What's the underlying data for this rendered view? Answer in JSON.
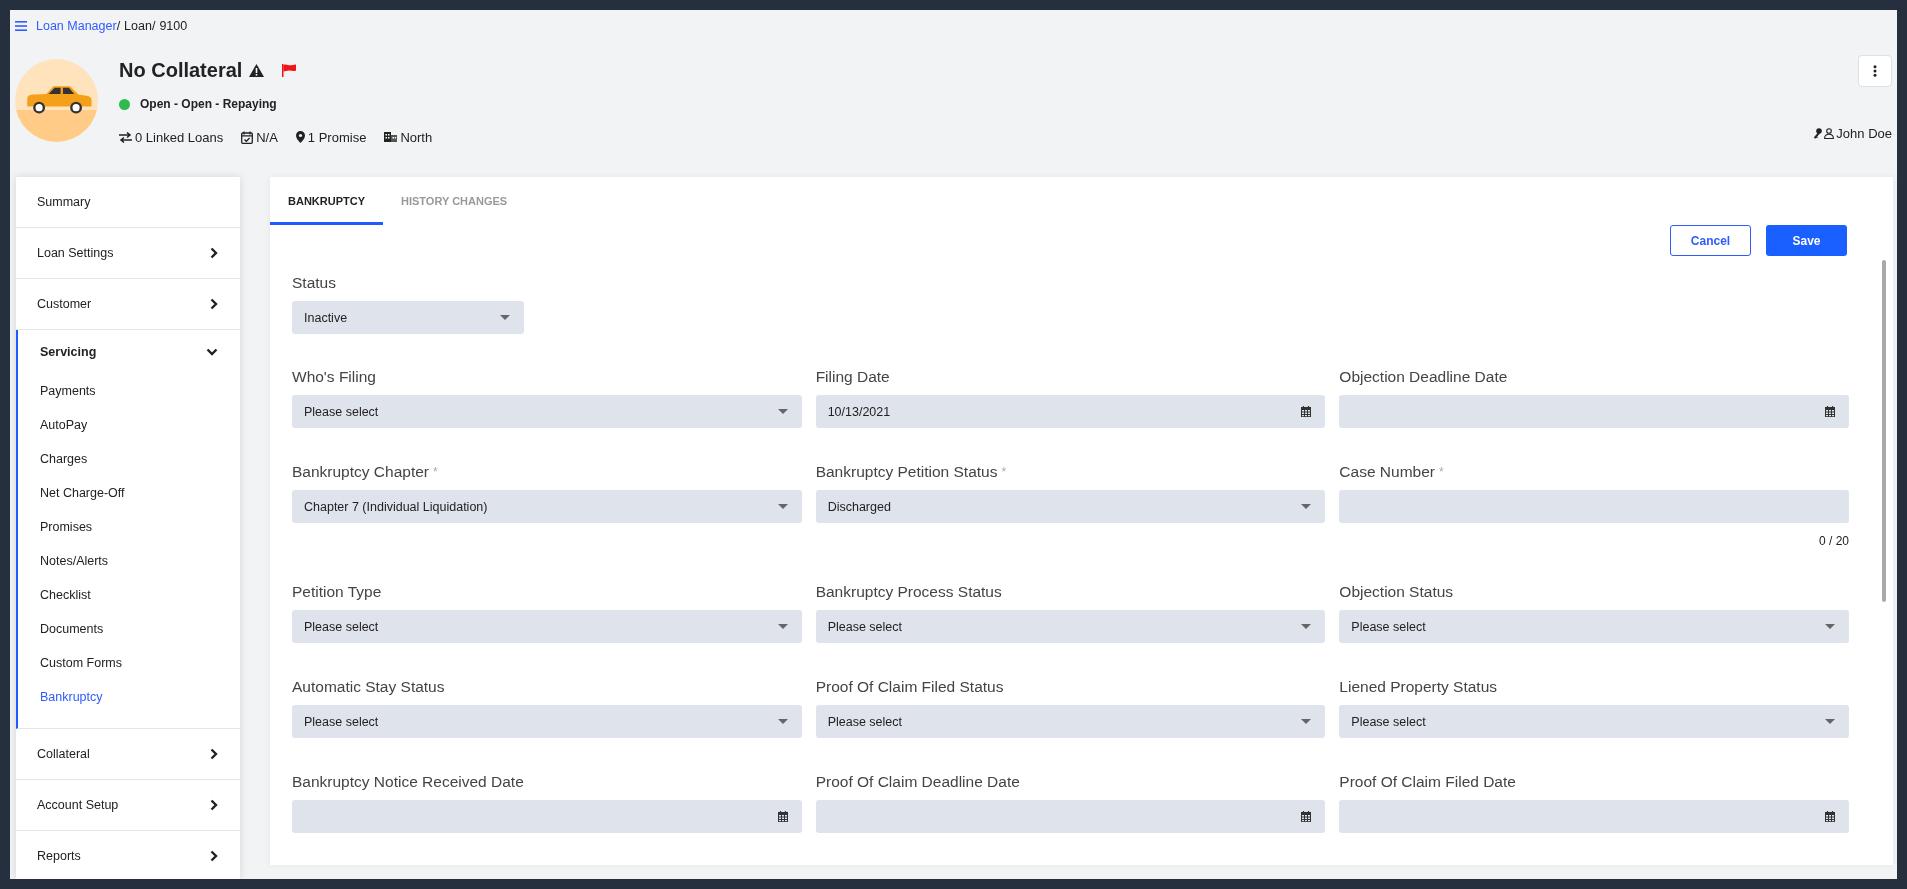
{
  "breadcrumb": {
    "separator": "/",
    "items": [
      {
        "label": "Loan Manager",
        "kind": "link"
      },
      {
        "label": "Loan",
        "kind": "text"
      },
      {
        "label": "9100",
        "kind": "text"
      }
    ]
  },
  "loan": {
    "title": "No Collateral",
    "warning": true,
    "flagged": true,
    "status": "Open - Open - Repaying",
    "meta": [
      {
        "kind": "linked",
        "text": "0 Linked Loans"
      },
      {
        "kind": "date",
        "text": "N/A"
      },
      {
        "kind": "promise",
        "text": "1 Promise"
      },
      {
        "kind": "region",
        "text": "North"
      }
    ],
    "user": "John Doe"
  },
  "sidebar": {
    "items": [
      {
        "label": "Summary",
        "expandable": false,
        "expanded": false
      },
      {
        "label": "Loan Settings",
        "expandable": true,
        "expanded": false
      },
      {
        "label": "Customer",
        "expandable": true,
        "expanded": false
      },
      {
        "label": "Servicing",
        "expandable": true,
        "expanded": true,
        "children": [
          {
            "label": "Payments",
            "selected": false
          },
          {
            "label": "AutoPay",
            "selected": false
          },
          {
            "label": "Charges",
            "selected": false
          },
          {
            "label": "Net Charge-Off",
            "selected": false
          },
          {
            "label": "Promises",
            "selected": false
          },
          {
            "label": "Notes/Alerts",
            "selected": false
          },
          {
            "label": "Checklist",
            "selected": false
          },
          {
            "label": "Documents",
            "selected": false
          },
          {
            "label": "Custom Forms",
            "selected": false
          },
          {
            "label": "Bankruptcy",
            "selected": true
          }
        ]
      },
      {
        "label": "Collateral",
        "expandable": true,
        "expanded": false
      },
      {
        "label": "Account Setup",
        "expandable": true,
        "expanded": false
      },
      {
        "label": "Reports",
        "expandable": true,
        "expanded": false
      }
    ]
  },
  "tabs": [
    {
      "label": "BANKRUPTCY",
      "selected": true
    },
    {
      "label": "HISTORY CHANGES",
      "selected": false
    }
  ],
  "actions": [
    {
      "label": "Cancel",
      "kind": "secondary"
    },
    {
      "label": "Save",
      "kind": "primary"
    }
  ],
  "required_mark": "*",
  "status_field": {
    "label": "Status",
    "kind": "select",
    "value": "Inactive"
  },
  "fields": [
    {
      "label": "Who's Filing",
      "kind": "select",
      "required": false,
      "value": "Please select"
    },
    {
      "label": "Filing Date",
      "kind": "date",
      "required": false,
      "value": "10/13/2021"
    },
    {
      "label": "Objection Deadline Date",
      "kind": "date",
      "required": false
    },
    {
      "label": "Bankruptcy Chapter",
      "kind": "select",
      "required": true,
      "value": "Chapter 7 (Individual Liquidation)"
    },
    {
      "label": "Bankruptcy Petition Status",
      "kind": "select",
      "required": true,
      "value": "Discharged"
    },
    {
      "label": "Case Number",
      "kind": "text",
      "required": true,
      "counter": "0 / 20"
    },
    {
      "label": "Petition Type",
      "kind": "select",
      "required": false,
      "value": "Please select"
    },
    {
      "label": "Bankruptcy Process Status",
      "kind": "select",
      "required": false,
      "value": "Please select"
    },
    {
      "label": "Objection Status",
      "kind": "select",
      "required": false,
      "value": "Please select"
    },
    {
      "label": "Automatic Stay Status",
      "kind": "select",
      "required": false,
      "value": "Please select"
    },
    {
      "label": "Proof Of Claim Filed Status",
      "kind": "select",
      "required": false,
      "value": "Please select"
    },
    {
      "label": "Liened Property Status",
      "kind": "select",
      "required": false,
      "value": "Please select"
    },
    {
      "label": "Bankruptcy Notice Received Date",
      "kind": "date",
      "required": false
    },
    {
      "label": "Proof Of Claim Deadline Date",
      "kind": "date",
      "required": false
    },
    {
      "label": "Proof Of Claim Filed Date",
      "kind": "date",
      "required": false
    }
  ]
}
